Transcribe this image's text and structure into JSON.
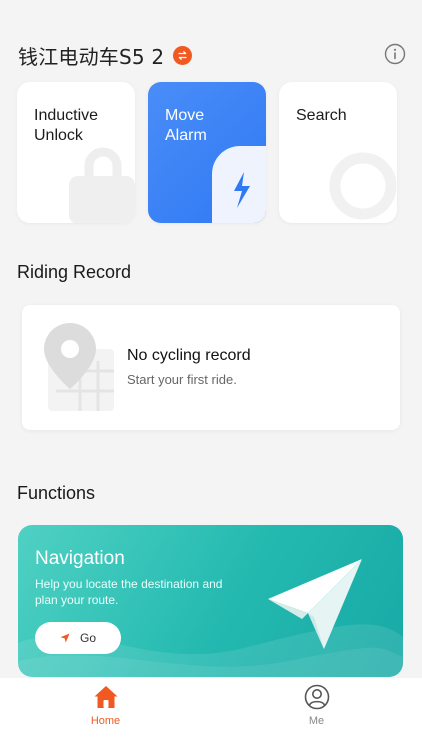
{
  "header": {
    "title": "钱江电动车S5 2"
  },
  "cards": [
    {
      "label": "Inductive\nUnlock",
      "icon": "lock-icon"
    },
    {
      "label": "Move\nAlarm",
      "icon": "lightning-icon"
    },
    {
      "label": "Search",
      "icon": "search-ring-icon"
    }
  ],
  "riding": {
    "section_title": "Riding Record",
    "empty_title": "No cycling record",
    "empty_sub": "Start your first ride."
  },
  "functions": {
    "section_title": "Functions",
    "navigation": {
      "title": "Navigation",
      "description": "Help you locate the destination and plan your route.",
      "button_label": "Go"
    }
  },
  "tabs": [
    {
      "label": "Home",
      "icon": "home-icon",
      "active": true
    },
    {
      "label": "Me",
      "icon": "user-icon",
      "active": false
    }
  ],
  "colors": {
    "accent": "#f05a22",
    "blue_card": "#2f79f3",
    "teal_card": "#23b9b0",
    "tab_inactive": "#888888"
  }
}
